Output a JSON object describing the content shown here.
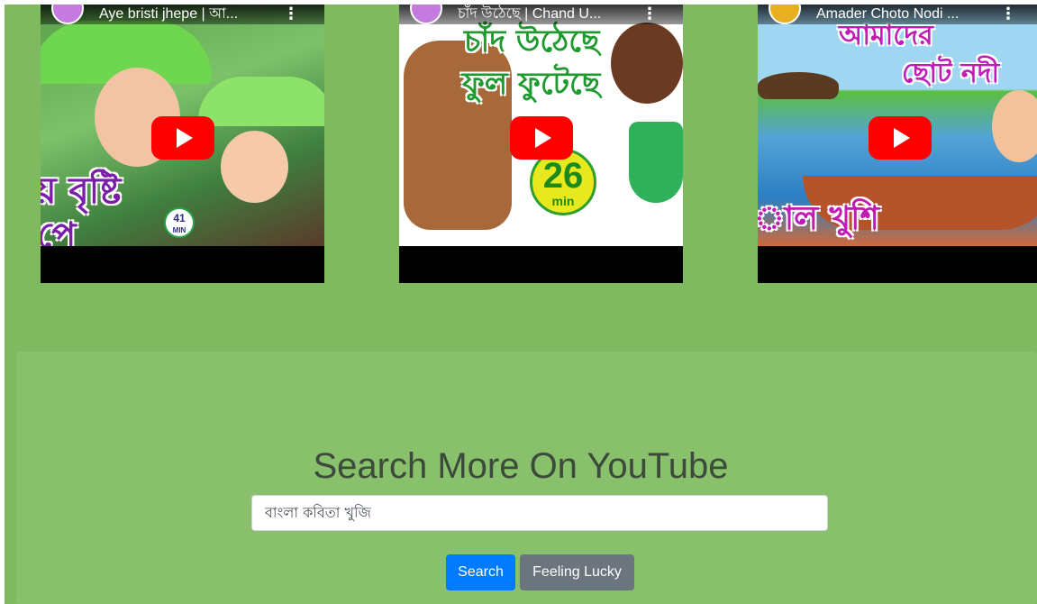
{
  "videos": [
    {
      "title": "Aye bristi jhepe | আ...",
      "thumb_text_top": "য় বৃষ্টি",
      "thumb_text_bottom": "পে",
      "badge_value": "41",
      "badge_unit": "MIN"
    },
    {
      "title": "চাঁদ উঠেছে | Chand U...",
      "thumb_text_top": "চাঁদ উঠেছে",
      "thumb_text_bottom": "ফুল ফুটেছে",
      "badge_value": "26",
      "badge_unit": "min"
    },
    {
      "title": "Amader Choto Nodi ...",
      "thumb_text_top": "আমাদের",
      "thumb_text_middle": "ছোট নদী",
      "thumb_text_bottom": "াল খুশি"
    }
  ],
  "search": {
    "heading": "Search More On YouTube",
    "input_value": "বাংলা কবিতা খুজি",
    "search_button": "Search",
    "lucky_button": "Feeling Lucky"
  },
  "colors": {
    "page_bg": "#7fba61",
    "jumbotron_bg": "#88c06b",
    "primary_button": "#007bff",
    "secondary_button": "#6c757d",
    "play_button": "#ff0000"
  }
}
